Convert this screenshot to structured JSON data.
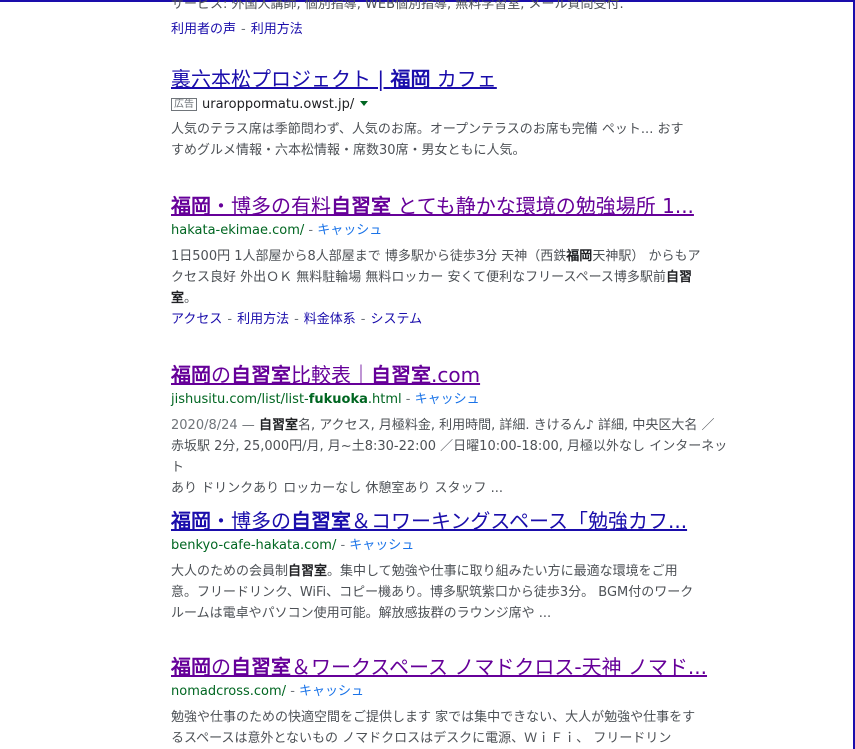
{
  "top_partial": {
    "snippet": "サービス: 外国人講師, 個別指導, WEB個別指導, 無料学習室, メール質問受付.",
    "sitelinks": [
      "利用者の声",
      "利用方法"
    ]
  },
  "results": [
    {
      "title_parts": [
        {
          "text": "裏六本松プロジェクト | ",
          "bold": false
        },
        {
          "text": "福岡",
          "bold": true
        },
        {
          "text": " カフェ",
          "bold": false
        }
      ],
      "ad_label": "広告",
      "url": "uraroppon matu.owst.jp/",
      "snippet_lines": [
        "人気のテラス席は季節問わず、人気のお席。オープンテラスのお席も完備 ペット... おす",
        "すめグルメ情報・六本松情報・席数30席・男女ともに人気。"
      ]
    },
    {
      "title": "福岡・博多の有料自習室 とても静かな環境の勉強場所 1...",
      "url": "hakata-ekimae.com/",
      "cache": "キャッシュ",
      "snippet_lines": [
        "1日500円 1人部屋から8人部屋まで 博多駅から徒歩3分 天神（西鉄福岡天神駅） からもア",
        "クセス良好 外出ＯＫ 無料駐輪場 無料ロッカー 安くて便利なフリースペース博多駅前自習",
        "室。"
      ],
      "sitelinks": [
        "アクセス",
        "利用方法",
        "料金体系",
        "システム"
      ]
    },
    {
      "title": "福岡の自習室比較表｜自習室.com",
      "url_prefix": "jishusitu.com/list/list-",
      "url_bold": "fukuoka",
      "url_suffix": ".html",
      "cache": "キャッシュ",
      "date": "2020/8/24",
      "snippet_lines": [
        "自習室名, アクセス, 月極料金, 利用時間, 詳細. きけるん♪ 詳細, 中央区大名 ／",
        "赤坂駅 2分, 25,000円/月, 月~土8:30-22:00 ／日曜10:00-18:00, 月極以外なし インターネット",
        "あり ドリンクあり ロッカーなし 休憩室あり スタッフ ..."
      ]
    },
    {
      "title": "福岡・博多の自習室＆コワーキングスペース「勉強カフ...",
      "url": "benkyo-cafe-hakata.com/",
      "cache": "キャッシュ",
      "snippet_lines": [
        "大人のための会員制自習室。集中して勉強や仕事に取り組みたい方に最適な環境をご用",
        "意。フリードリンク、WiFi、コピー機あり。博多駅筑紫口から徒歩3分。 BGM付のワーク",
        "ルームは電卓やパソコン使用可能。解放感抜群のラウンジ席や ..."
      ]
    },
    {
      "title": "福岡の自習室＆ワークスペース ノマドクロス-天神 ノマド...",
      "url": "nomadcross.com/",
      "cache": "キャッシュ",
      "snippet_lines": [
        "勉強や仕事のための快適空間をご提供します 家では集中できない、大人が勉強や仕事をす",
        "るスペースは意外とないもの ノマドクロスはデスクに電源、ＷｉＦｉ、 フリードリン"
      ]
    }
  ],
  "colors": {
    "visited_title": "#660099",
    "link": "#1a0dab",
    "url_green": "#006621",
    "snippet": "#4d5156"
  }
}
